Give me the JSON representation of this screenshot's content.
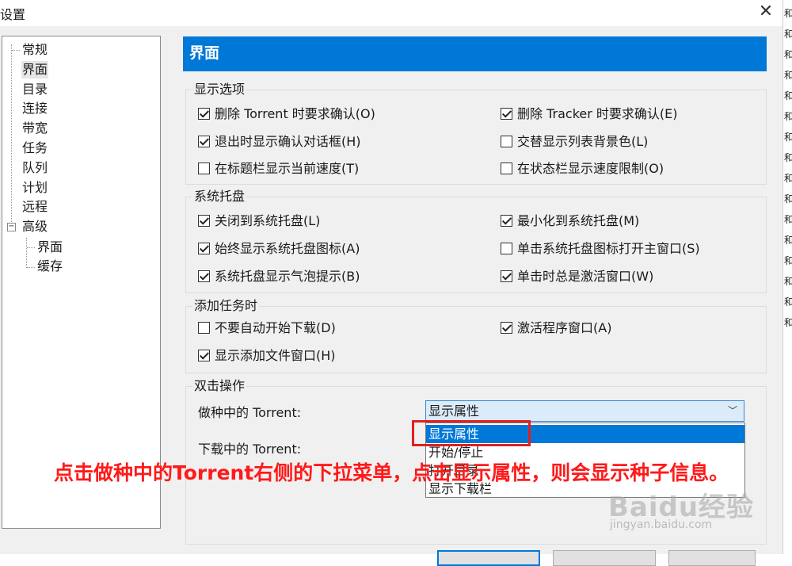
{
  "window": {
    "title": "设置",
    "close_symbol": "✕"
  },
  "tree": {
    "items": [
      "常规",
      "界面",
      "目录",
      "连接",
      "带宽",
      "任务",
      "队列",
      "计划",
      "远程",
      "高级"
    ],
    "expander_symbol": "−",
    "sub_items": [
      "界面",
      "缓存"
    ],
    "selected": "界面"
  },
  "page": {
    "header": "界面",
    "display_options": {
      "title": "显示选项",
      "items": [
        {
          "label": "删除 Torrent 时要求确认(O)",
          "checked": true
        },
        {
          "label": "删除 Tracker 时要求确认(E)",
          "checked": true
        },
        {
          "label": "退出时显示确认对话框(H)",
          "checked": true
        },
        {
          "label": "交替显示列表背景色(L)",
          "checked": false
        },
        {
          "label": "在标题栏显示当前速度(T)",
          "checked": false
        },
        {
          "label": "在状态栏显示速度限制(O)",
          "checked": false
        }
      ]
    },
    "tray": {
      "title": "系统托盘",
      "items": [
        {
          "label": "关闭到系统托盘(L)",
          "checked": true
        },
        {
          "label": "最小化到系统托盘(M)",
          "checked": true
        },
        {
          "label": "始终显示系统托盘图标(A)",
          "checked": true
        },
        {
          "label": "单击系统托盘图标打开主窗口(S)",
          "checked": false
        },
        {
          "label": "系统托盘显示气泡提示(B)",
          "checked": true
        },
        {
          "label": "单击时总是激活窗口(W)",
          "checked": true
        }
      ]
    },
    "add_task": {
      "title": "添加任务时",
      "items": [
        {
          "label": "不要自动开始下载(D)",
          "checked": false
        },
        {
          "label": "激活程序窗口(A)",
          "checked": true
        },
        {
          "label": "显示添加文件窗口(H)",
          "checked": true
        }
      ]
    },
    "double_click": {
      "title": "双击操作",
      "seeding_label": "做种中的 Torrent:",
      "seeding_value": "显示属性",
      "downloading_label": "下载中的 Torrent:",
      "chevron_symbol": "﹀",
      "dropdown_options": [
        "显示属性",
        "开始/停止",
        "打开目录",
        "显示下载栏"
      ],
      "dropdown_selected_index": 0
    }
  },
  "annotation": "点击做种中的Torrent右侧的下拉菜单，点击显示属性，则会显示种子信息。",
  "watermark": {
    "brand": "Baidu经验",
    "url": "jingyan.baidu.com"
  },
  "right_strip_char": "和",
  "colors": {
    "accent": "#0078d7",
    "annotation_red": "#ff1a1a",
    "selection_bg": "#dcebfa"
  }
}
